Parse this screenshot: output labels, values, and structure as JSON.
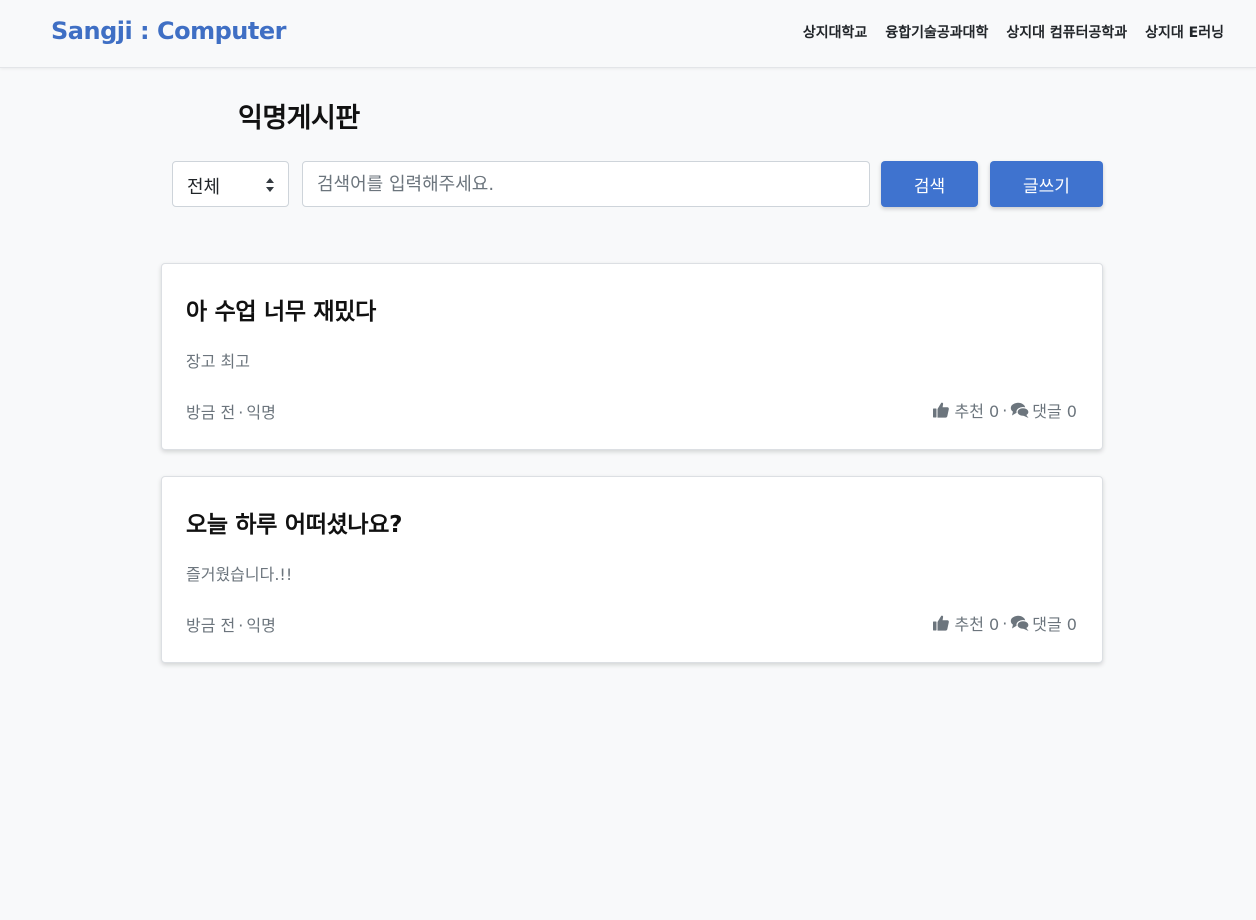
{
  "navbar": {
    "brand": "Sangji : Computer",
    "links": [
      {
        "label": "상지대학교"
      },
      {
        "label": "융합기술공과대학"
      },
      {
        "label": "상지대 컴퓨터공학과"
      },
      {
        "label": "상지대 E러닝"
      }
    ]
  },
  "page": {
    "title": "익명게시판"
  },
  "search": {
    "filter_value": "전체",
    "placeholder": "검색어를 입력해주세요.",
    "search_label": "검색",
    "write_label": "글쓰기"
  },
  "posts": [
    {
      "title": "아 수업 너무 재밌다",
      "body": "장고 최고",
      "time": "방금 전",
      "author": "익명",
      "likes_label": "추천 0",
      "comments_label": "댓글 0"
    },
    {
      "title": "오늘 하루 어떠셨나요?",
      "body": "즐거웠습니다.!!",
      "time": "방금 전",
      "author": "익명",
      "likes_label": "추천 0",
      "comments_label": "댓글 0"
    }
  ],
  "colors": {
    "brand": "#3f6fc4",
    "primary_button": "#3f73cf",
    "muted_text": "#6c757d",
    "background": "#f8f9fa"
  },
  "icons": {
    "like": "thumbs-up-icon",
    "comment": "comments-icon",
    "select": "sort-arrows-icon"
  }
}
